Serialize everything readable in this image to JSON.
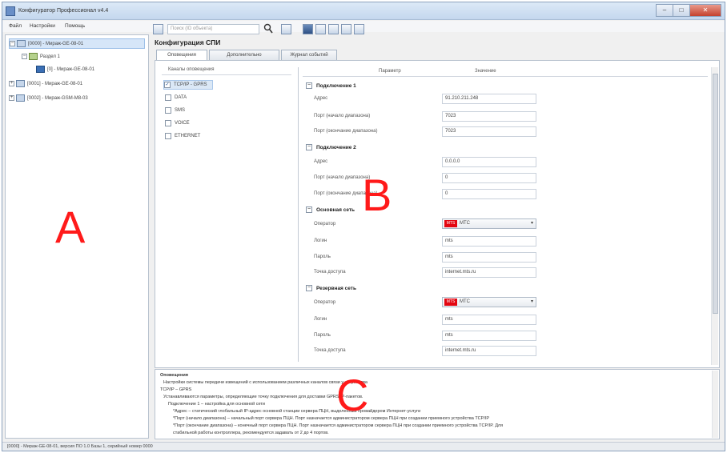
{
  "window": {
    "title": "Конфигуратор Профессионал v4.4",
    "controls": [
      "–",
      "□",
      "✕"
    ]
  },
  "menu": [
    "Файл",
    "Настройки",
    "Помощь"
  ],
  "tree": [
    {
      "label": "[0000] - Мираж-GE-08-01"
    },
    {
      "label": "Раздел 1"
    },
    {
      "label": "[0] - Мираж-GE-08-01"
    },
    {
      "label": "[0001] - Мираж-GE-08-01"
    },
    {
      "label": "[0002] - Мираж-GSM-M8-03"
    }
  ],
  "toolbar": {
    "search_placeholder": "Поиск (ID объекта)"
  },
  "config_title": "Конфигурация СПИ",
  "tabs": [
    "Оповещения",
    "Дополнительно",
    "Журнал событий"
  ],
  "channels": {
    "header": "Каналы оповещения",
    "items": [
      {
        "label": "TCP/IP - GPRS",
        "checked": true
      },
      {
        "label": "DATA",
        "checked": false
      },
      {
        "label": "SMS",
        "checked": false
      },
      {
        "label": "VOICE",
        "checked": false
      },
      {
        "label": "ETHERNET",
        "checked": false
      }
    ]
  },
  "grid": {
    "col_param": "Параметр",
    "col_value": "Значение",
    "groups": [
      {
        "title": "Подключение 1",
        "rows": [
          {
            "label": "Адрес",
            "value": "91.210.211.248"
          },
          {
            "label": "Порт (начало диапазона)",
            "value": "7023"
          },
          {
            "label": "Порт (окончание диапазона)",
            "value": "7023"
          }
        ]
      },
      {
        "title": "Подключение 2",
        "rows": [
          {
            "label": "Адрес",
            "value": "0.0.0.0"
          },
          {
            "label": "Порт (начало диапазона)",
            "value": "0"
          },
          {
            "label": "Порт (окончание диапазона)",
            "value": "0"
          }
        ]
      },
      {
        "title": "Основная сеть",
        "rows": [
          {
            "label": "Оператор",
            "value": "МТС",
            "select": true
          },
          {
            "label": "Логин",
            "value": "mts"
          },
          {
            "label": "Пароль",
            "value": "mts"
          },
          {
            "label": "Точка доступа",
            "value": "internet.mts.ru"
          }
        ]
      },
      {
        "title": "Резервная сеть",
        "rows": [
          {
            "label": "Оператор",
            "value": "МТС",
            "select": true
          },
          {
            "label": "Логин",
            "value": "mts"
          },
          {
            "label": "Пароль",
            "value": "mts"
          },
          {
            "label": "Точка доступа",
            "value": "internet.mts.ru"
          }
        ]
      }
    ]
  },
  "mts_logo": "MTS",
  "description": [
    "Оповещения",
    "Настройки системы передачи извещений с использованием различных каналов связи у устройства",
    "TCP/IP – GPRS",
    "Устанавливаются параметры, определяющие точку подключения для доставки GPRS IP-пакетов.",
    "Подключение 1 – настройка для основной сети",
    "*Адрес – статический глобальный IP-адрес основной станции сервера ПЦН, выделенный провайдером Интернет-услуги",
    "*Порт (начало диапазона) – начальный порт сервера ПЦН. Порт назначается администратором сервера ПЦН при создании приемного устройства TCP/IP",
    "*Порт (окончание диапазона) – конечный порт сервера ПЦН. Порт назначается администратором сервера ПЦН при создании приемного устройства TCP/IP. Для",
    "стабильной работы контроллера, рекомендуется задавать от 2 до 4 портов."
  ],
  "status": "[0000] - Мираж-GE-08-01, версия ПО 1.0 Базы 1, серийный номер 0000",
  "labels": {
    "a": "A",
    "b": "B",
    "c": "C"
  },
  "colors": {
    "accent": "#3b6fb5",
    "annotation": "#ff1a1a",
    "mts": "#e30611"
  }
}
